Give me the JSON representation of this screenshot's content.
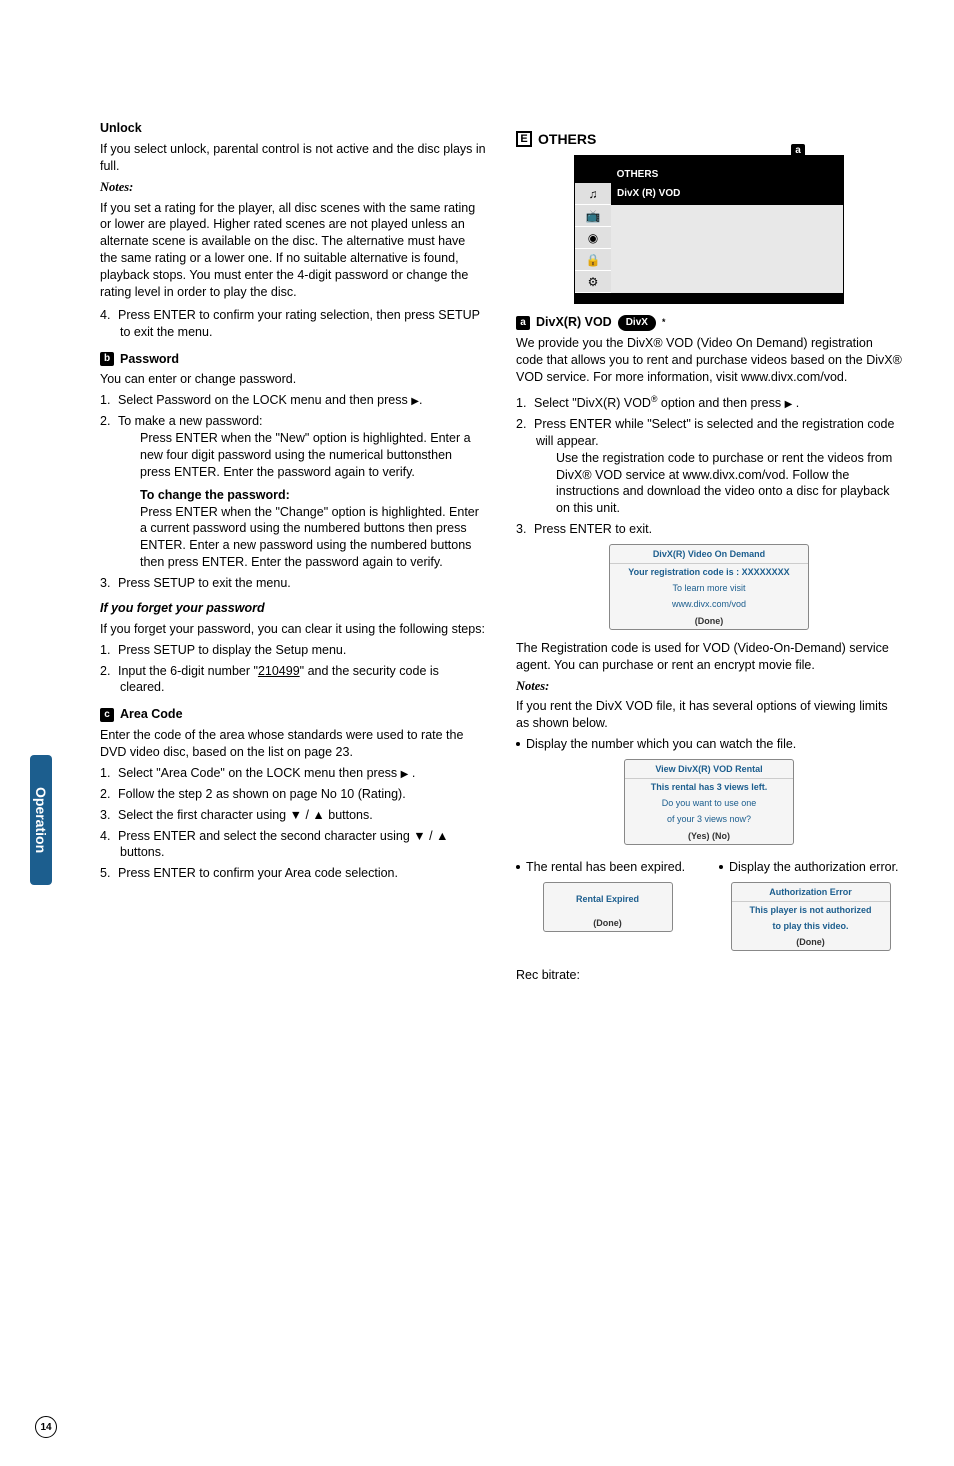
{
  "sideTab": "Operation",
  "pageNumber": "14",
  "left": {
    "unlock": {
      "title": "Unlock",
      "body": "If you select unlock, parental control is not active and the disc plays in full."
    },
    "notesLabel": "Notes:",
    "notesBody": "If you set a rating for the player, all disc scenes with the same rating or lower are played. Higher rated scenes are not played unless an alternate scene is available on the disc. The alternative must have the same rating or a lower one. If no suitable alternative is found, playback stops. You must enter the 4-digit password or change the rating level in order to play the disc.",
    "step4": "Press ENTER to confirm your rating selection, then press SETUP to exit the menu.",
    "password": {
      "letter": "b",
      "title": "Password",
      "intro": "You can enter or change password.",
      "s1": "Select Password on the LOCK menu and then press",
      "s2a": "To make a new password:",
      "s2b": "Press ENTER when the \"New\" option is highlighted. Enter a new four digit password using the numerical buttonsthen press ENTER. Enter the password again to verify.",
      "changeTitle": "To change the password:",
      "changeBody": "Press ENTER when the \"Change\" option is highlighted. Enter a current password using the numbered buttons then press ENTER. Enter a new password using the numbered buttons then press ENTER. Enter the password again to verify.",
      "s3": "Press SETUP to exit the menu."
    },
    "forgot": {
      "title": "If you forget your password",
      "body": "If you forget your password, you can clear it using the following steps:",
      "s1": "Press SETUP to display the Setup menu.",
      "s2a": "Input the 6-digit number \"",
      "s2num": "210499",
      "s2b": "\" and the security code is cleared."
    },
    "area": {
      "letter": "c",
      "title": "Area Code",
      "body1": "Enter the code of the area whose standards were used to rate the DVD video disc, based on the list on ",
      "body2": "page 23.",
      "s1": "Select \"Area Code\" on the LOCK menu then press",
      "s2": "Follow the step 2 as shown on page No 10 (Rating).",
      "s3": "Select the first character using  ▼ / ▲  buttons.",
      "s4": "Press ENTER and select the second character using  ▼ / ▲  buttons.",
      "s5": "Press ENTER to confirm your Area code selection."
    }
  },
  "right": {
    "others": {
      "letter": "E",
      "title": "OTHERS",
      "menu": {
        "tab": "OTHERS",
        "item": "DivX (R) VOD",
        "badge": "a"
      }
    },
    "divx": {
      "letter": "a",
      "title": "DivX(R) VOD",
      "pill": "DivX",
      "body": "We provide you the DivX® VOD (Video On Demand) registration code that allows you to rent and purchase videos based on the DivX® VOD service. For more information, visit www.divx.com/vod.",
      "s1a": "Select \"DivX(R) VOD",
      "s1b": " option and then press",
      "s2": "Press ENTER while \"Select\" is selected and the registration code will appear.",
      "s2b": "Use the registration code to purchase or rent the videos from DivX® VOD service at www.divx.com/vod. Follow the instructions and download the video onto a disc for playback on this unit.",
      "s3": "Press ENTER to exit."
    },
    "dialog1": {
      "title": "DivX(R) Video On Demand",
      "l1": "Your registration code is : XXXXXXXX",
      "l2": "To learn more visit",
      "l3": "www.divx.com/vod",
      "done": "(Done)"
    },
    "regText": "The Registration code is used for VOD (Video-On-Demand) service agent. You can purchase or rent an encrypt movie file.",
    "notesLabel": "Notes:",
    "notesBody": "If you rent the DivX VOD file, it has several options of viewing limits as shown below.",
    "bullet1": "Display the number which you can watch the file.",
    "dialog2": {
      "title": "View DivX(R) VOD Rental",
      "l1": "This rental has 3 views left.",
      "l2": "Do you want to use one",
      "l3": "of your 3 views now?",
      "done": "(Yes) (No)"
    },
    "bullet2": "The rental has been expired.",
    "bullet3": "Display the authorization error.",
    "dialog3": {
      "l1": "Rental Expired",
      "done": "(Done)"
    },
    "dialog4": {
      "title": "Authorization Error",
      "l1": "This player is not authorized",
      "l2": "to play this video.",
      "done": "(Done)"
    },
    "rec": "Rec bitrate:"
  }
}
